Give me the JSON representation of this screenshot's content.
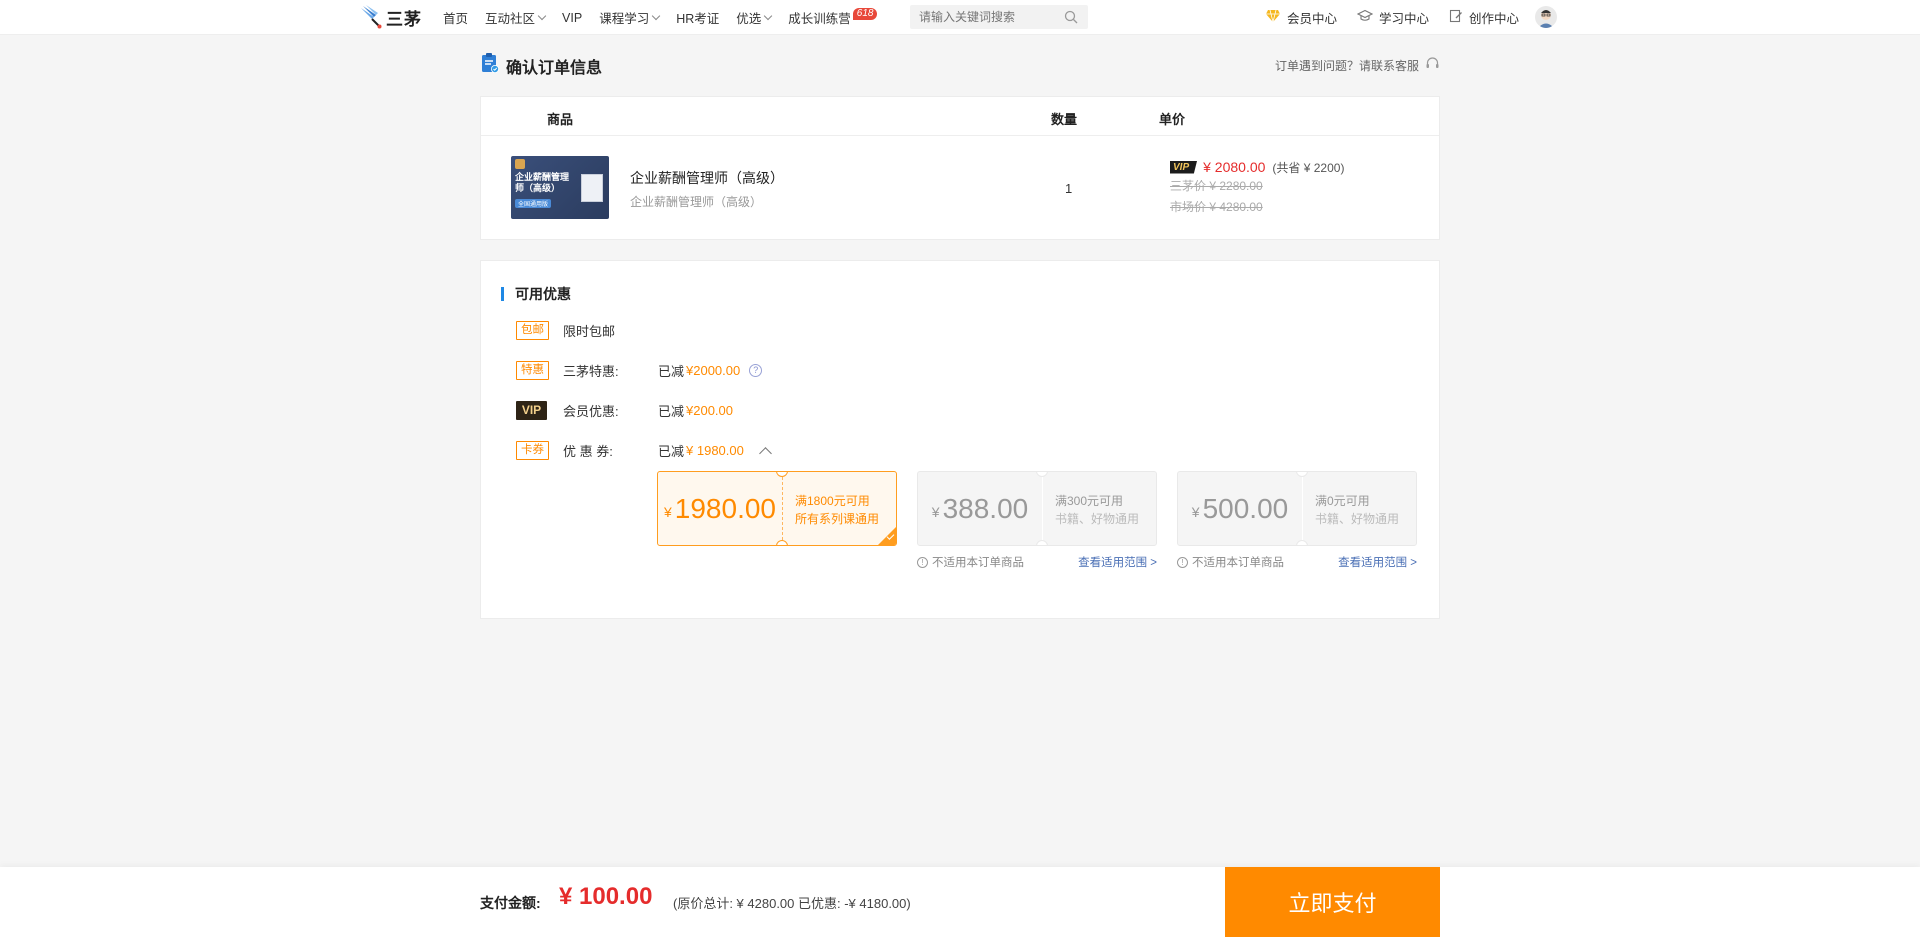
{
  "header": {
    "logo_text": "三茅",
    "nav": [
      {
        "label": "首页",
        "has_dropdown": false
      },
      {
        "label": "互动社区",
        "has_dropdown": true
      },
      {
        "label": "VIP",
        "has_dropdown": false
      },
      {
        "label": "课程学习",
        "has_dropdown": true
      },
      {
        "label": "HR考证",
        "has_dropdown": false
      },
      {
        "label": "优选",
        "has_dropdown": true
      },
      {
        "label": "成长训练营",
        "has_dropdown": false,
        "badge": "618"
      }
    ],
    "search_placeholder": "请输入关键词搜索",
    "right_nav": [
      {
        "label": "会员中心",
        "icon": "diamond-icon"
      },
      {
        "label": "学习中心",
        "icon": "graduation-cap-icon"
      },
      {
        "label": "创作中心",
        "icon": "edit-icon"
      }
    ]
  },
  "page": {
    "title": "确认订单信息",
    "help_text": "订单遇到问题？请联系客服"
  },
  "order": {
    "columns": [
      "商品",
      "数量",
      "单价"
    ],
    "product": {
      "image_title": "企业薪酬管理师（高级）",
      "image_tag": "全国通用版",
      "name": "企业薪酬管理师（高级）",
      "subtitle": "企业薪酬管理师（高级）",
      "quantity": "1",
      "vip_label": "VIP",
      "price": "¥ 2080.00",
      "savings": "(共省 ¥ 2200)",
      "sanmao_price": "三茅价 ¥ 2280.00",
      "market_price": "市场价 ¥ 4280.00"
    }
  },
  "promotions": {
    "title": "可用优惠",
    "rows": [
      {
        "tag": "包邮",
        "label": "限时包邮",
        "prefix": "",
        "amount": ""
      },
      {
        "tag": "特惠",
        "label": "三茅特惠:",
        "prefix": "已减",
        "amount": "¥2000.00",
        "help": "?"
      },
      {
        "tag": "VIP",
        "label": "会员优惠:",
        "prefix": "已减",
        "amount": "¥200.00"
      },
      {
        "tag": "卡券",
        "label": "优 惠 券:",
        "prefix": "已减",
        "amount": "¥ 1980.00"
      }
    ],
    "coupons": [
      {
        "currency": "¥",
        "amount": "1980.00",
        "line1": "满1800元可用",
        "line2": "所有系列课通用",
        "selected": true,
        "not_applicable": "",
        "scope_link": ""
      },
      {
        "currency": "¥",
        "amount": "388.00",
        "line1": "满300元可用",
        "line2": "书籍、好物通用",
        "selected": false,
        "not_applicable": "不适用本订单商品",
        "scope_link": "查看适用范围 >"
      },
      {
        "currency": "¥",
        "amount": "500.00",
        "line1": "满0元可用",
        "line2": "书籍、好物通用",
        "selected": false,
        "not_applicable": "不适用本订单商品",
        "scope_link": "查看适用范围 >"
      }
    ]
  },
  "footer": {
    "pay_label": "支付金额:",
    "pay_amount": "¥ 100.00",
    "pay_detail": "(原价总计: ¥ 4280.00   已优惠: -¥ 4180.00)",
    "pay_button": "立即支付"
  },
  "colors": {
    "accent": "#ff8a00",
    "price_red": "#e52c2c",
    "title_bar_blue": "#1e88e5",
    "badge_red": "#e8483a"
  }
}
